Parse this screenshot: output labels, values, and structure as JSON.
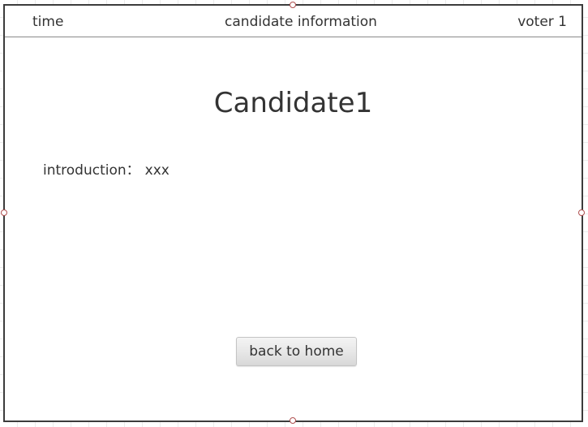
{
  "header": {
    "time_label": "time",
    "title": "candidate information",
    "voter_label": "voter 1"
  },
  "candidate": {
    "name": "Candidate1",
    "intro_label": "introduction：",
    "intro_value": "xxx"
  },
  "actions": {
    "back_label": "back to home"
  }
}
